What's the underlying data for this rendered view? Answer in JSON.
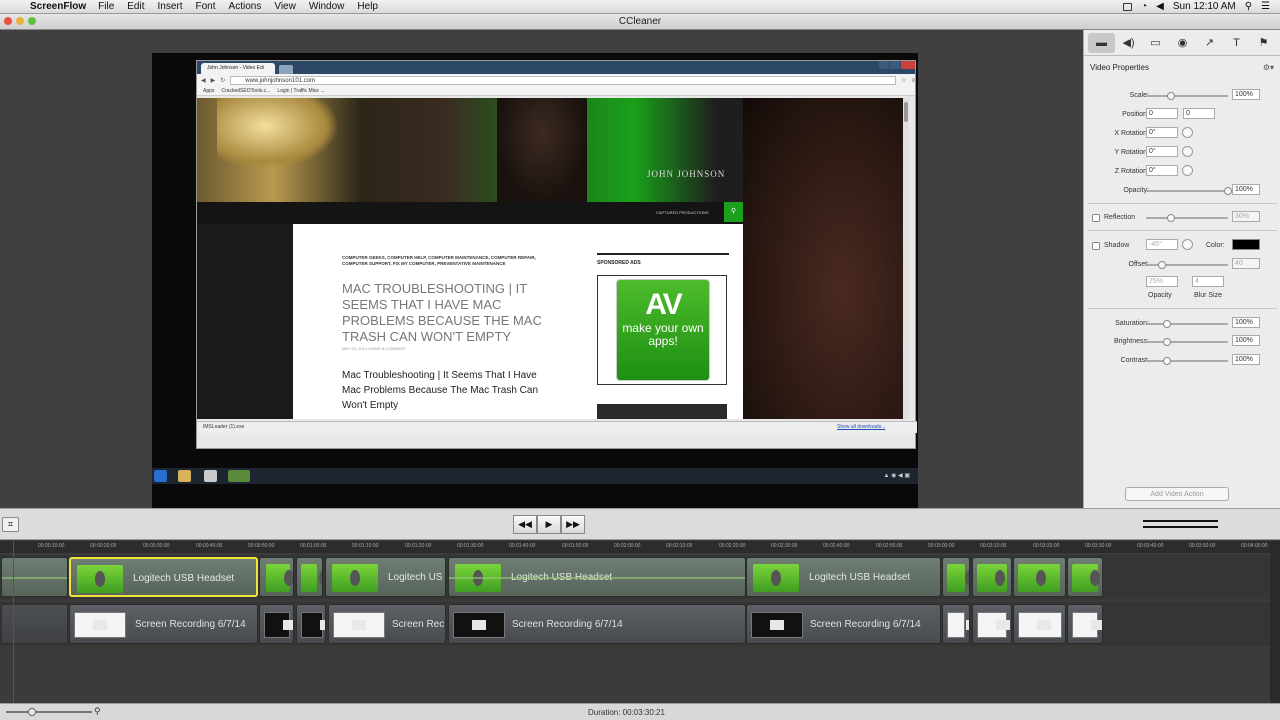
{
  "menubar": {
    "app_name": "ScreenFlow",
    "items": [
      "File",
      "Edit",
      "Insert",
      "Font",
      "Actions",
      "View",
      "Window",
      "Help"
    ],
    "clock": "Sun 12:10 AM"
  },
  "window": {
    "title": "CCleaner"
  },
  "browser": {
    "tab_title": "John Johnson - Video Edi",
    "url": "www.johnjohnson101.com",
    "bookmarks": [
      "Apps",
      "CrackedSEOTools.c...",
      "Login | Traffic Mice ..."
    ],
    "download_file": "IMSLoader (1).exe",
    "download_all": "Show all downloads..."
  },
  "site": {
    "brand": "JOHN JOHNSON",
    "nav_item": "CAPTURED PRODUCTIONS",
    "categories": "COMPUTER GEEKS, COMPUTER HELP, COMPUTER MAINTENANCE, COMPUTER REPAIR, COMPUTER SUPPORT, FIX MY COMPUTER, PREVENTATIVE MAINTENANCE",
    "headline": "MAC TROUBLESHOOTING | IT SEEMS THAT I HAVE MAC PROBLEMS BECAUSE THE MAC TRASH CAN WON'T EMPTY",
    "meta": "MAY 23, 2014   LEAVE A COMMENT",
    "subheadline": "Mac Troubleshooting | It Seems That I Have Mac Problems Because The Mac Trash Can Won't Empty",
    "sponsored": "SPONSORED ADS",
    "ad_logo": "AV",
    "ad_text": "make your own apps!"
  },
  "inspector": {
    "title": "Video Properties",
    "scale": {
      "label": "Scale:",
      "value": "100%",
      "level": 0.3
    },
    "position": {
      "label": "Position:",
      "x": "0",
      "y": "0"
    },
    "x_rotation": {
      "label": "X Rotation:",
      "value": "0°"
    },
    "y_rotation": {
      "label": "Y Rotation:",
      "value": "0°"
    },
    "z_rotation": {
      "label": "Z Rotation:",
      "value": "0°"
    },
    "opacity": {
      "label": "Opacity:",
      "value": "100%",
      "level": 1.0
    },
    "reflection": {
      "label": "Reflection",
      "value": "30%",
      "level": 0.3
    },
    "shadow": {
      "label": "Shadow",
      "angle": "-45°",
      "color_label": "Color:",
      "color": "#000000"
    },
    "offset": {
      "label": "Offset:",
      "value": "40",
      "level": 0.2
    },
    "shadow_opacity": {
      "value": "75%",
      "label": "Opacity"
    },
    "blur": {
      "value": "4",
      "label": "Blur Size"
    },
    "saturation": {
      "label": "Saturation:",
      "value": "100%",
      "level": 0.25
    },
    "brightness": {
      "label": "Brightness:",
      "value": "100%",
      "level": 0.25
    },
    "contrast": {
      "label": "Contrast:",
      "value": "100%",
      "level": 0.25
    },
    "add_action": "Add Video Action"
  },
  "transport": {
    "rewind": "◀◀",
    "play": "▶",
    "forward": "▶▶"
  },
  "ruler": [
    "00:00:10:00",
    "00:00:20:00",
    "00:00:30:00",
    "00:00:40:00",
    "00:00:50:00",
    "00:01:00:00",
    "00:01:10:00",
    "00:01:20:00",
    "00:01:30:00",
    "00:01:40:00",
    "00:01:50:00",
    "00:02:00:00",
    "00:02:10:00",
    "00:02:20:00",
    "00:02:30:00",
    "00:02:40:00",
    "00:02:50:00",
    "00:03:00:00",
    "00:03:10:00",
    "00:03:20:00",
    "00:03:30:00",
    "00:03:40:00",
    "00:03:50:00",
    "00:04:00:00"
  ],
  "tracks": {
    "audio_label": "Logitech USB Headset",
    "audio_label_short": "Logitech US",
    "video_label": "Screen Recording 6/7/14",
    "video_label_short": "Screen Rec"
  },
  "status": {
    "duration": "Duration: 00:03:30:21"
  }
}
